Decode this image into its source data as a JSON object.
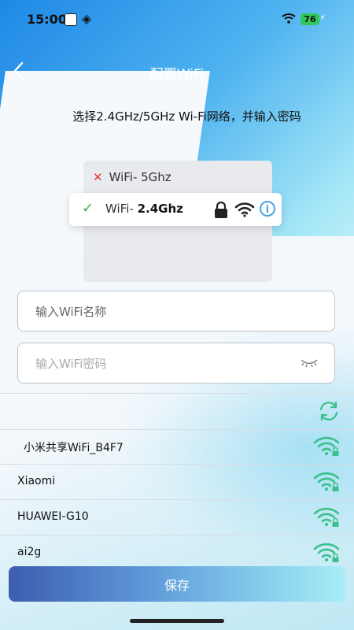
{
  "status_bar": {
    "time": "15:00",
    "battery": "76"
  },
  "header": {
    "title": "配置WiFi"
  },
  "subtitle": "选择2.4GHz/5GHz Wi-Fi网络，并输入密码",
  "illustration": {
    "row_5g": "WiFi- 5Ghz",
    "row_24_prefix": "WiFi-",
    "row_24_band": "2.4Ghz"
  },
  "form": {
    "ssid_placeholder": "输入WiFi名称",
    "password_placeholder": "输入WiFi密码"
  },
  "networks": [
    {
      "name": "小米共享WiFi_B4F7"
    },
    {
      "name": "Xiaomi"
    },
    {
      "name": "HUAWEI-G10"
    },
    {
      "name": "ai2g"
    }
  ],
  "actions": {
    "save_label": "保存"
  },
  "colors": {
    "accent_green": "#3cbf8c",
    "title_text": "#ffffff",
    "info_blue": "#4aa3e0"
  }
}
